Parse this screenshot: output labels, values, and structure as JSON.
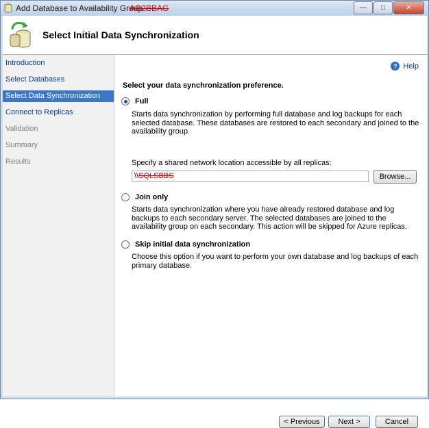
{
  "window": {
    "title": "Add Database to Availability Group - ",
    "title_redacted": "AG2BBAG",
    "caption_buttons": [
      "minimize",
      "maximize",
      "close"
    ]
  },
  "banner": {
    "title": "Select Initial Data Synchronization",
    "icon": "database-sync-icon"
  },
  "nav": {
    "items": [
      {
        "label": "Introduction",
        "state": "link"
      },
      {
        "label": "Select Databases",
        "state": "link"
      },
      {
        "label": "Select Data Synchronization",
        "state": "active"
      },
      {
        "label": "Connect to Replicas",
        "state": "link"
      },
      {
        "label": "Validation",
        "state": "disabled"
      },
      {
        "label": "Summary",
        "state": "disabled"
      },
      {
        "label": "Results",
        "state": "disabled"
      }
    ]
  },
  "main": {
    "help_label": "Help",
    "heading": "Select your data synchronization preference.",
    "options": [
      {
        "label": "Full",
        "checked": true,
        "description": "Starts data synchronization by performing full database and log backups for each selected database. These databases are restored to each secondary and joined to the availability group."
      },
      {
        "label": "Join only",
        "checked": false,
        "description": "Starts data synchronization where you have already restored database and log backups to each secondary server. The selected databases are joined to the availability group on each secondary. This action will be skipped for Azure replicas."
      },
      {
        "label": "Skip initial data synchronization",
        "checked": false,
        "description": "Choose this option if you want to perform your own database and log backups of each primary database."
      }
    ],
    "share_label": "Specify a shared network location accessible by all replicas:",
    "share_prefix": "\\\\",
    "share_redacted": "SQLSBBS",
    "browse_label": "Browse..."
  },
  "footer": {
    "previous_label": "< Previous",
    "next_label": "Next >",
    "cancel_label": "Cancel"
  }
}
